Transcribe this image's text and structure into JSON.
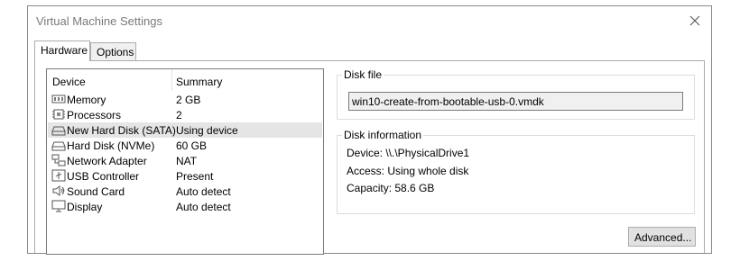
{
  "window": {
    "title": "Virtual Machine Settings",
    "close_icon": "close-icon"
  },
  "tabs": [
    {
      "label": "Hardware",
      "active": true
    },
    {
      "label": "Options",
      "active": false
    }
  ],
  "device_list": {
    "headers": {
      "device": "Device",
      "summary": "Summary"
    },
    "rows": [
      {
        "icon": "memory-icon",
        "device": "Memory",
        "summary": "2 GB",
        "selected": false
      },
      {
        "icon": "processor-icon",
        "device": "Processors",
        "summary": "2",
        "selected": false
      },
      {
        "icon": "hard-disk-icon",
        "device": "New Hard Disk (SATA)",
        "summary": "Using device",
        "selected": true
      },
      {
        "icon": "hard-disk-icon",
        "device": "Hard Disk (NVMe)",
        "summary": "60 GB",
        "selected": false
      },
      {
        "icon": "network-adapter-icon",
        "device": "Network Adapter",
        "summary": "NAT",
        "selected": false
      },
      {
        "icon": "usb-icon",
        "device": "USB Controller",
        "summary": "Present",
        "selected": false
      },
      {
        "icon": "speaker-icon",
        "device": "Sound Card",
        "summary": "Auto detect",
        "selected": false
      },
      {
        "icon": "monitor-icon",
        "device": "Display",
        "summary": "Auto detect",
        "selected": false
      }
    ]
  },
  "disk_file": {
    "label": "Disk file",
    "value": "win10-create-from-bootable-usb-0.vmdk"
  },
  "disk_info": {
    "label": "Disk information",
    "device": "Device:  \\\\.\\PhysicalDrive1",
    "access": "Access:  Using whole disk",
    "capacity": "Capacity:  58.6 GB"
  },
  "buttons": {
    "advanced": "Advanced..."
  }
}
